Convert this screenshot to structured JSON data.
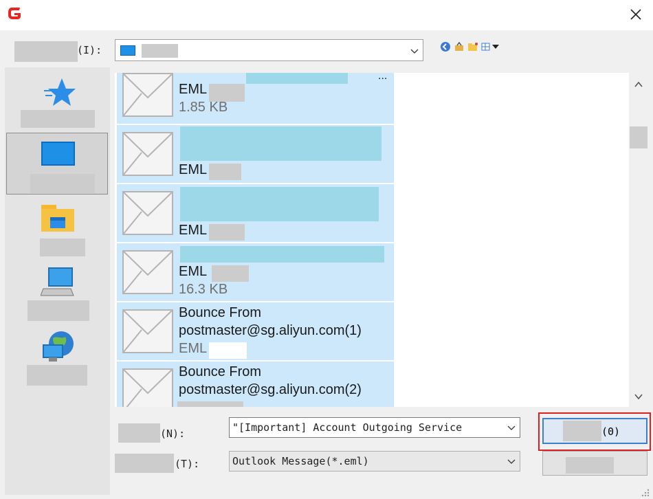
{
  "window": {
    "close_glyph": "✕",
    "logo_icon": "app-logo-icon"
  },
  "look_in": {
    "label": "(I):",
    "value_icon": "desktop-icon"
  },
  "files": [
    {
      "type_label": "EML",
      "size": "1.85 KB",
      "more": "..."
    },
    {
      "type_label": "EML",
      "size": ""
    },
    {
      "type_label": "EML",
      "size": ""
    },
    {
      "type_label": "EML",
      "size": "16.3 KB"
    },
    {
      "name_line1": "Bounce From",
      "name_line2": "postmaster@sg.aliyun.com(1)",
      "type_label": "EML"
    },
    {
      "name_line1": "Bounce From",
      "name_line2": "postmaster@sg.aliyun.com(2)"
    }
  ],
  "file_name": {
    "label": "(N):",
    "value": "\"[Important] Account Outgoing Service"
  },
  "file_type": {
    "label": "(T):",
    "value": "Outlook Message(*.eml)"
  },
  "open_button": {
    "label": "(0)"
  },
  "places": [
    "quick-access",
    "desktop",
    "libraries",
    "this-pc",
    "network"
  ],
  "colors": {
    "selection": "#cde8fb",
    "accent": "#1e90e6",
    "highlight_border": "#e02020"
  }
}
